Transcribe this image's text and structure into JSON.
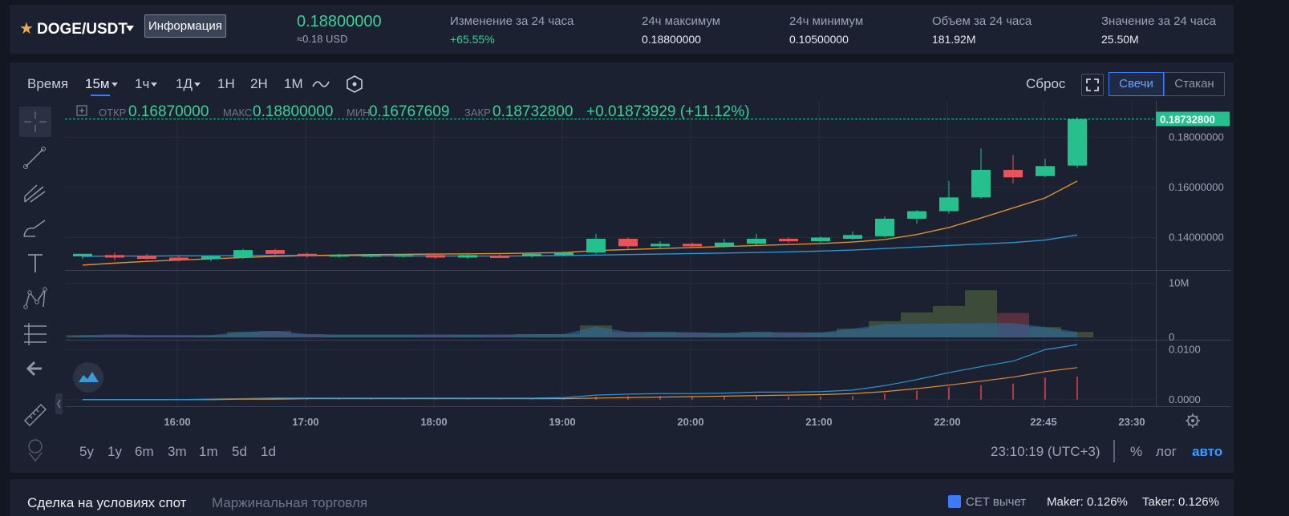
{
  "ticker": {
    "pair": "DOGE/USDT",
    "info_button": "Информация",
    "last_price": "0.18800000",
    "last_price_usd": "≈0.18 USD",
    "stats": [
      {
        "label": "Изменение за 24 часа",
        "value": "+65.55%",
        "green": true
      },
      {
        "label": "24ч максимум",
        "value": "0.18800000",
        "green": false
      },
      {
        "label": "24ч минимум",
        "value": "0.10500000",
        "green": false
      },
      {
        "label": "Объем за 24 часа",
        "value": "181.92M",
        "green": false
      },
      {
        "label": "Значение за 24 часа",
        "value": "25.50M",
        "green": false
      }
    ]
  },
  "toolbar": {
    "time_label": "Время",
    "intervals": [
      "15м",
      "1ч",
      "1Д",
      "1Н",
      "2Н",
      "1М"
    ],
    "active_interval": "15м",
    "reset": "Сброс",
    "candles_button": "Свечи",
    "depth_button": "Стакан"
  },
  "ohlc": {
    "open_label": "ОТКР",
    "open": "0.16870000",
    "high_label": "МАКС",
    "high": "0.18800000",
    "low_label": "МИН",
    "low": "0.16767609",
    "close_label": "ЗАКР",
    "close": "0.18732800",
    "change": "+0.01873929 (+11.12%)"
  },
  "price_tag": "0.18732800",
  "y_ticks": [
    {
      "value": 0.18,
      "label": "0.18000000"
    },
    {
      "value": 0.16,
      "label": "0.16000000"
    },
    {
      "value": 0.14,
      "label": "0.14000000"
    }
  ],
  "volume_ticks": [
    {
      "value": 10000000,
      "label": "10M"
    },
    {
      "value": 0,
      "label": "0"
    }
  ],
  "indicator_ticks": [
    {
      "value": 0.01,
      "label": "0.0100"
    },
    {
      "value": 0,
      "label": "0.0000"
    }
  ],
  "x_ticks": [
    "16:00",
    "17:00",
    "18:00",
    "19:00",
    "20:00",
    "21:00",
    "22:00",
    "22:45",
    "23:30"
  ],
  "ranges": [
    "5y",
    "1y",
    "6m",
    "3m",
    "1m",
    "5d",
    "1d"
  ],
  "clock": "23:10:19 (UTC+3)",
  "scale_pct": "%",
  "scale_log": "лог",
  "scale_auto": "авто",
  "bottom": {
    "tab_spot": "Сделка на условиях спот",
    "tab_margin": "Маржинальная торговля",
    "cet_label": "CET вычет",
    "maker": "Maker: 0.126%",
    "taker": "Taker: 0.126%"
  },
  "colors": {
    "up": "#26c08f",
    "down": "#e8545a",
    "ma_fast": "#e0902f",
    "ma_slow": "#2e95d3",
    "accent": "#3b7bff"
  },
  "chart_data": {
    "type": "candlestick",
    "x_unit": "time of day (15m candles)",
    "candles": [
      {
        "t": "15:30",
        "o": 0.1325,
        "h": 0.1335,
        "l": 0.1315,
        "c": 0.1335
      },
      {
        "t": "15:45",
        "o": 0.133,
        "h": 0.134,
        "l": 0.131,
        "c": 0.132
      },
      {
        "t": "16:00",
        "o": 0.1325,
        "h": 0.1335,
        "l": 0.131,
        "c": 0.1315
      },
      {
        "t": "16:15",
        "o": 0.132,
        "h": 0.133,
        "l": 0.1305,
        "c": 0.131
      },
      {
        "t": "16:30",
        "o": 0.1315,
        "h": 0.133,
        "l": 0.1305,
        "c": 0.1325
      },
      {
        "t": "16:45",
        "o": 0.132,
        "h": 0.1355,
        "l": 0.1315,
        "c": 0.135
      },
      {
        "t": "17:00",
        "o": 0.135,
        "h": 0.1355,
        "l": 0.133,
        "c": 0.1335
      },
      {
        "t": "17:15",
        "o": 0.1335,
        "h": 0.134,
        "l": 0.132,
        "c": 0.1325
      },
      {
        "t": "17:30",
        "o": 0.1325,
        "h": 0.1335,
        "l": 0.132,
        "c": 0.133
      },
      {
        "t": "17:45",
        "o": 0.1325,
        "h": 0.1335,
        "l": 0.132,
        "c": 0.133
      },
      {
        "t": "18:00",
        "o": 0.1325,
        "h": 0.1335,
        "l": 0.132,
        "c": 0.133
      },
      {
        "t": "18:15",
        "o": 0.133,
        "h": 0.1335,
        "l": 0.1315,
        "c": 0.132
      },
      {
        "t": "18:30",
        "o": 0.132,
        "h": 0.1335,
        "l": 0.1315,
        "c": 0.133
      },
      {
        "t": "18:45",
        "o": 0.1325,
        "h": 0.1335,
        "l": 0.132,
        "c": 0.132
      },
      {
        "t": "19:00",
        "o": 0.1325,
        "h": 0.134,
        "l": 0.132,
        "c": 0.1335
      },
      {
        "t": "19:15",
        "o": 0.133,
        "h": 0.1345,
        "l": 0.1325,
        "c": 0.134
      },
      {
        "t": "19:30",
        "o": 0.134,
        "h": 0.1415,
        "l": 0.1335,
        "c": 0.1395
      },
      {
        "t": "19:45",
        "o": 0.1395,
        "h": 0.14,
        "l": 0.1355,
        "c": 0.1365
      },
      {
        "t": "20:00",
        "o": 0.1365,
        "h": 0.1385,
        "l": 0.1355,
        "c": 0.1375
      },
      {
        "t": "20:15",
        "o": 0.1375,
        "h": 0.138,
        "l": 0.136,
        "c": 0.1365
      },
      {
        "t": "20:30",
        "o": 0.1365,
        "h": 0.1395,
        "l": 0.136,
        "c": 0.138
      },
      {
        "t": "20:45",
        "o": 0.1375,
        "h": 0.1415,
        "l": 0.137,
        "c": 0.1395
      },
      {
        "t": "21:00",
        "o": 0.1395,
        "h": 0.14,
        "l": 0.138,
        "c": 0.1385
      },
      {
        "t": "21:15",
        "o": 0.1385,
        "h": 0.1405,
        "l": 0.138,
        "c": 0.14
      },
      {
        "t": "21:30",
        "o": 0.1395,
        "h": 0.1425,
        "l": 0.139,
        "c": 0.141
      },
      {
        "t": "21:45",
        "o": 0.1405,
        "h": 0.1485,
        "l": 0.14,
        "c": 0.1475
      },
      {
        "t": "22:00",
        "o": 0.1475,
        "h": 0.151,
        "l": 0.1455,
        "c": 0.1505
      },
      {
        "t": "22:15",
        "o": 0.1505,
        "h": 0.1625,
        "l": 0.1495,
        "c": 0.156
      },
      {
        "t": "22:30",
        "o": 0.156,
        "h": 0.1755,
        "l": 0.1555,
        "c": 0.167
      },
      {
        "t": "22:45",
        "o": 0.167,
        "h": 0.173,
        "l": 0.1615,
        "c": 0.164
      },
      {
        "t": "23:00",
        "o": 0.1645,
        "h": 0.1715,
        "l": 0.164,
        "c": 0.1685
      },
      {
        "t": "23:15",
        "o": 0.1687,
        "h": 0.188,
        "l": 0.1677,
        "c": 0.1873
      }
    ],
    "ma_fast": [
      0.129,
      0.1298,
      0.1305,
      0.131,
      0.1315,
      0.132,
      0.1325,
      0.1328,
      0.133,
      0.1332,
      0.1333,
      0.1334,
      0.1335,
      0.1336,
      0.1338,
      0.134,
      0.1348,
      0.1352,
      0.1356,
      0.136,
      0.1364,
      0.1368,
      0.1372,
      0.1376,
      0.1382,
      0.1392,
      0.1412,
      0.144,
      0.1478,
      0.1518,
      0.1558,
      0.1625
    ],
    "ma_slow": [
      0.1325,
      0.1326,
      0.1326,
      0.1327,
      0.1327,
      0.1328,
      0.1328,
      0.1328,
      0.1328,
      0.1327,
      0.1327,
      0.1326,
      0.1326,
      0.1326,
      0.1327,
      0.1328,
      0.133,
      0.1332,
      0.1334,
      0.1336,
      0.1338,
      0.134,
      0.1343,
      0.1346,
      0.135,
      0.1356,
      0.1362,
      0.1368,
      0.1374,
      0.138,
      0.139,
      0.141
    ],
    "volume": [
      0.4,
      0.5,
      0.4,
      0.4,
      0.4,
      1.0,
      1.2,
      0.6,
      0.5,
      0.5,
      0.5,
      0.5,
      0.5,
      0.5,
      0.6,
      0.6,
      2.2,
      1.0,
      1.0,
      0.9,
      0.8,
      1.0,
      0.9,
      0.9,
      1.6,
      3.0,
      4.6,
      5.8,
      8.7,
      4.5,
      1.9,
      1.0
    ],
    "volume_unit": "M",
    "volume_ylim": [
      0,
      12
    ],
    "ylim": [
      0.128,
      0.19
    ],
    "macd_fast": [
      0,
      0,
      0,
      0,
      0.0001,
      0.0002,
      0.0003,
      0.0003,
      0.0003,
      0.0003,
      0.0003,
      0.0003,
      0.0003,
      0.0003,
      0.0003,
      0.0004,
      0.0009,
      0.0011,
      0.0012,
      0.0012,
      0.0013,
      0.0015,
      0.0015,
      0.0016,
      0.0019,
      0.0028,
      0.004,
      0.0054,
      0.0066,
      0.0077,
      0.01,
      0.011
    ],
    "macd_slow": [
      0,
      0,
      0,
      0,
      0,
      0.0001,
      0.0001,
      0.0002,
      0.0002,
      0.0002,
      0.0002,
      0.0002,
      0.0002,
      0.0002,
      0.0002,
      0.0002,
      0.0003,
      0.0004,
      0.0005,
      0.0006,
      0.0007,
      0.0008,
      0.0009,
      0.001,
      0.0012,
      0.0016,
      0.0022,
      0.0029,
      0.0037,
      0.0045,
      0.0056,
      0.0064
    ],
    "macd_ylim": [
      -0.001,
      0.0115
    ]
  }
}
